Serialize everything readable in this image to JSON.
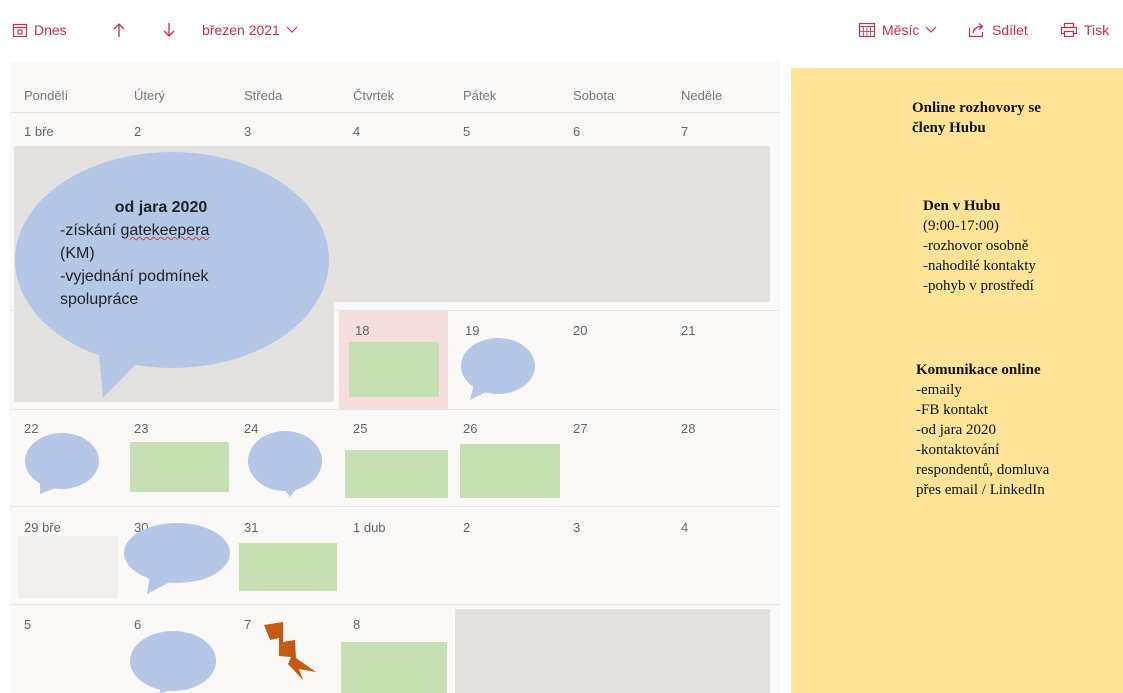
{
  "toolbar": {
    "today_label": "Dnes",
    "month_label": "březen 2021",
    "view_label": "Měsíc",
    "share_label": "Sdílet",
    "print_label": "Tisk",
    "accent_color": "#c4314b"
  },
  "calendar": {
    "weekdays": [
      "Pondělí",
      "Úterý",
      "Středa",
      "Čtvrtek",
      "Pátek",
      "Sobota",
      "Neděle"
    ],
    "weeks": [
      [
        "1 bře",
        "2",
        "3",
        "4",
        "5",
        "6",
        "7"
      ],
      [
        "",
        "",
        "",
        "18",
        "19",
        "20",
        "21"
      ],
      [
        "22",
        "23",
        "24",
        "25",
        "26",
        "27",
        "28"
      ],
      [
        "29 bře",
        "30",
        "31",
        "1 dub",
        "2",
        "3",
        "4"
      ],
      [
        "5",
        "6",
        "7",
        "8",
        "",
        "",
        ""
      ]
    ],
    "bubble": {
      "title": "od jara 2020",
      "line1_prefix": "-získání ",
      "line1_word": "gatekeepera",
      "line2": "(KM)",
      "line3": "-vyjednání podmínek",
      "line4": "spolupráce"
    }
  },
  "legend": {
    "item1": {
      "title_line1": "Online rozhovory se",
      "title_line2": "členy Hubu"
    },
    "item2": {
      "title": "Den v Hubu",
      "lines": [
        "(9:00-17:00)",
        "-rozhovor osobně",
        "-nahodilé kontakty",
        "-pohyb v prostředí"
      ]
    },
    "item3": {
      "title": "Komunikace online",
      "lines": [
        "-emaily",
        "-FB kontakt",
        "-od jara 2020",
        "-kontaktování",
        "respondentů, domluva",
        "přes email / LinkedIn"
      ]
    },
    "colors": {
      "green": "#c6e0b4",
      "bubble": "#b4c7e7",
      "bolt": "#c55a11",
      "background": "#ffe397"
    }
  }
}
